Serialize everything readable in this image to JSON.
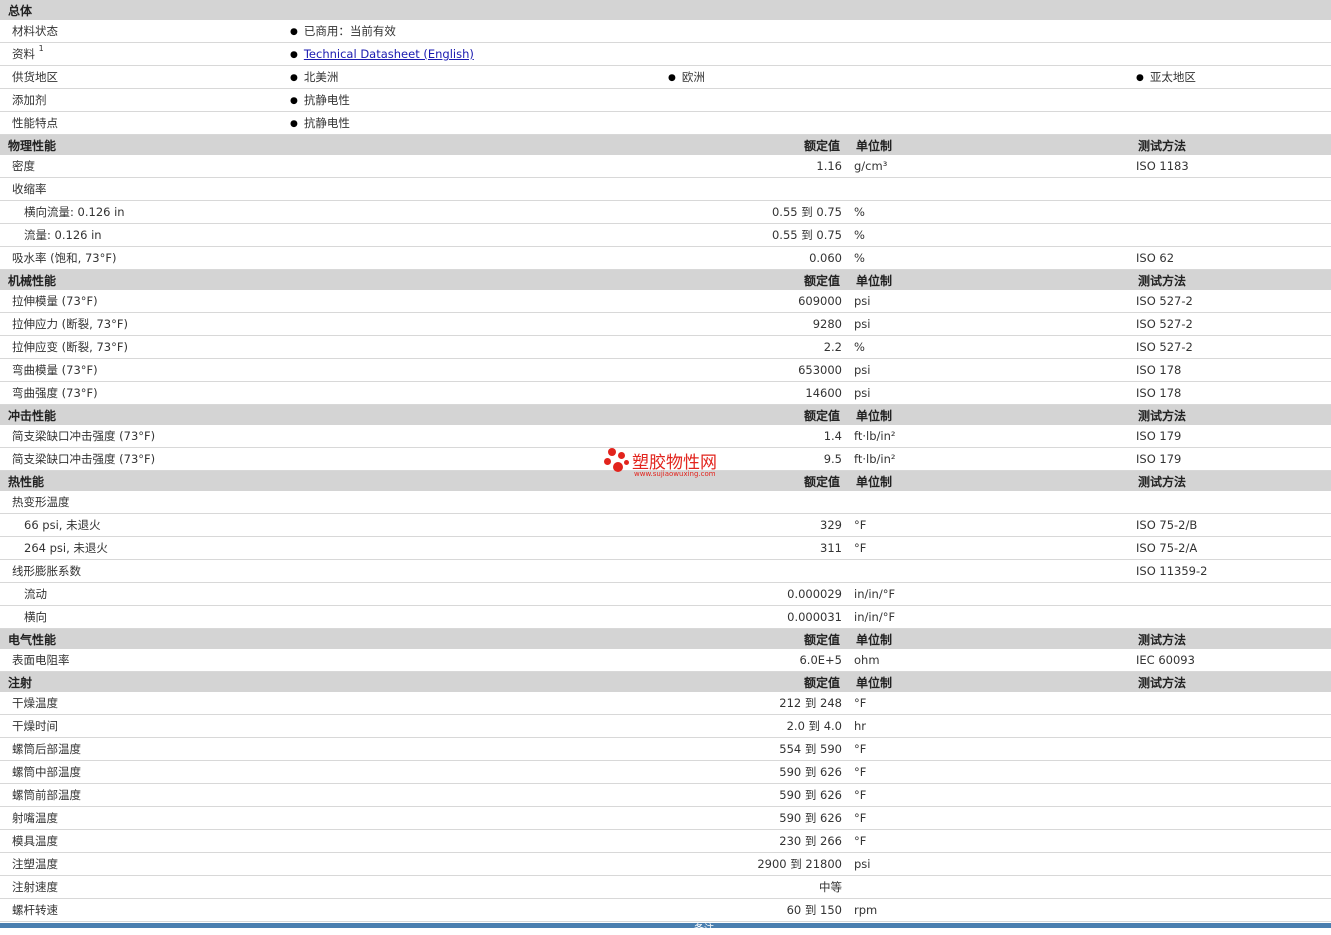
{
  "general": {
    "title": "总体",
    "rows": [
      {
        "label": "材料状态",
        "value": "已商用：当前有效"
      },
      {
        "label": "资料",
        "sup": "1",
        "link": "Technical Datasheet (English)"
      },
      {
        "label": "供货地区",
        "values": [
          "北美洲",
          "欧洲",
          "亚太地区"
        ]
      },
      {
        "label": "添加剂",
        "value": "抗静电性"
      },
      {
        "label": "性能特点",
        "value": "抗静电性"
      }
    ]
  },
  "col_headers": {
    "nominal": "额定值",
    "unit": "单位制",
    "method": "测试方法"
  },
  "physical": {
    "title": "物理性能",
    "rows": [
      {
        "label": "密度",
        "value": "1.16",
        "unit": "g/cm³",
        "method": "ISO 1183"
      },
      {
        "label": "收缩率"
      },
      {
        "label": "横向流量: 0.126 in",
        "sub": true,
        "value": "0.55 到  0.75",
        "unit": "%"
      },
      {
        "label": "流量: 0.126 in",
        "sub": true,
        "value": "0.55 到  0.75",
        "unit": "%"
      },
      {
        "label": "吸水率 (饱和, 73°F)",
        "value": "0.060",
        "unit": "%",
        "method": "ISO 62"
      }
    ]
  },
  "mechanical": {
    "title": "机械性能",
    "rows": [
      {
        "label": "拉伸模量 (73°F)",
        "value": "609000",
        "unit": "psi",
        "method": "ISO 527-2"
      },
      {
        "label": "拉伸应力 (断裂, 73°F)",
        "value": "9280",
        "unit": "psi",
        "method": "ISO 527-2"
      },
      {
        "label": "拉伸应变 (断裂, 73°F)",
        "value": "2.2",
        "unit": "%",
        "method": "ISO 527-2"
      },
      {
        "label": "弯曲模量 (73°F)",
        "value": "653000",
        "unit": "psi",
        "method": "ISO 178"
      },
      {
        "label": "弯曲强度 (73°F)",
        "value": "14600",
        "unit": "psi",
        "method": "ISO 178"
      }
    ]
  },
  "impact": {
    "title": "冲击性能",
    "rows": [
      {
        "label": "简支梁缺口冲击强度 (73°F)",
        "value": "1.4",
        "unit": "ft·lb/in²",
        "method": "ISO 179"
      },
      {
        "label": "简支梁缺口冲击强度 (73°F)",
        "value": "9.5",
        "unit": "ft·lb/in²",
        "method": "ISO 179"
      }
    ]
  },
  "thermal": {
    "title": "热性能",
    "rows": [
      {
        "label": "热变形温度"
      },
      {
        "label": "66 psi, 未退火",
        "sub": true,
        "value": "329",
        "unit": "°F",
        "method": "ISO 75-2/B"
      },
      {
        "label": "264 psi, 未退火",
        "sub": true,
        "value": "311",
        "unit": "°F",
        "method": "ISO 75-2/A"
      },
      {
        "label": "线形膨胀系数",
        "method": "ISO 11359-2"
      },
      {
        "label": "流动",
        "sub": true,
        "value": "0.000029",
        "unit": "in/in/°F"
      },
      {
        "label": "横向",
        "sub": true,
        "value": "0.000031",
        "unit": "in/in/°F"
      }
    ]
  },
  "electrical": {
    "title": "电气性能",
    "rows": [
      {
        "label": "表面电阻率",
        "value": "6.0E+5",
        "unit": "ohm",
        "method": "IEC 60093"
      }
    ]
  },
  "injection": {
    "title": "注射",
    "rows": [
      {
        "label": "干燥温度",
        "value": "212 到  248",
        "unit": "°F"
      },
      {
        "label": "干燥时间",
        "value": "2.0 到  4.0",
        "unit": "hr"
      },
      {
        "label": "螺筒后部温度",
        "value": "554 到  590",
        "unit": "°F"
      },
      {
        "label": "螺筒中部温度",
        "value": "590 到  626",
        "unit": "°F"
      },
      {
        "label": "螺筒前部温度",
        "value": "590 到  626",
        "unit": "°F"
      },
      {
        "label": "射嘴温度",
        "value": "590 到  626",
        "unit": "°F"
      },
      {
        "label": "模具温度",
        "value": "230 到  266",
        "unit": "°F"
      },
      {
        "label": "注塑温度",
        "value": "2900 到  21800",
        "unit": "psi"
      },
      {
        "label": "注射速度",
        "value": "中等"
      },
      {
        "label": "螺杆转速",
        "value": "60 到  150",
        "unit": "rpm"
      }
    ]
  },
  "footer": {
    "label": "备注"
  },
  "watermark": {
    "name": "塑胶物性网",
    "url": "www.sujiaowuxing.com",
    "color": "#e2241d"
  }
}
